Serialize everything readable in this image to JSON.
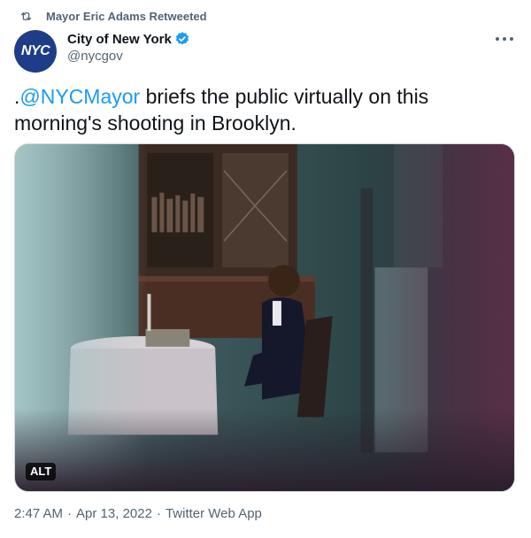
{
  "retweet": {
    "label": "Mayor Eric Adams Retweeted",
    "icon": "retweet-icon"
  },
  "author": {
    "avatar_text": "NYC",
    "avatar_color": "#1f3c88",
    "display_name": "City of New York",
    "handle": "@nycgov",
    "verified": true,
    "verified_color": "#1d9bf0"
  },
  "tweet": {
    "prefix": ".",
    "mention": "@NYCMayor",
    "body": " briefs the public virtually on this morning's shooting in Brooklyn."
  },
  "media": {
    "alt_label": "ALT"
  },
  "meta": {
    "time": "2:47 AM",
    "date": "Apr 13, 2022",
    "separator": "·",
    "app": "Twitter Web App"
  },
  "colors": {
    "link": "#1d9bf0",
    "secondary": "#536471"
  }
}
